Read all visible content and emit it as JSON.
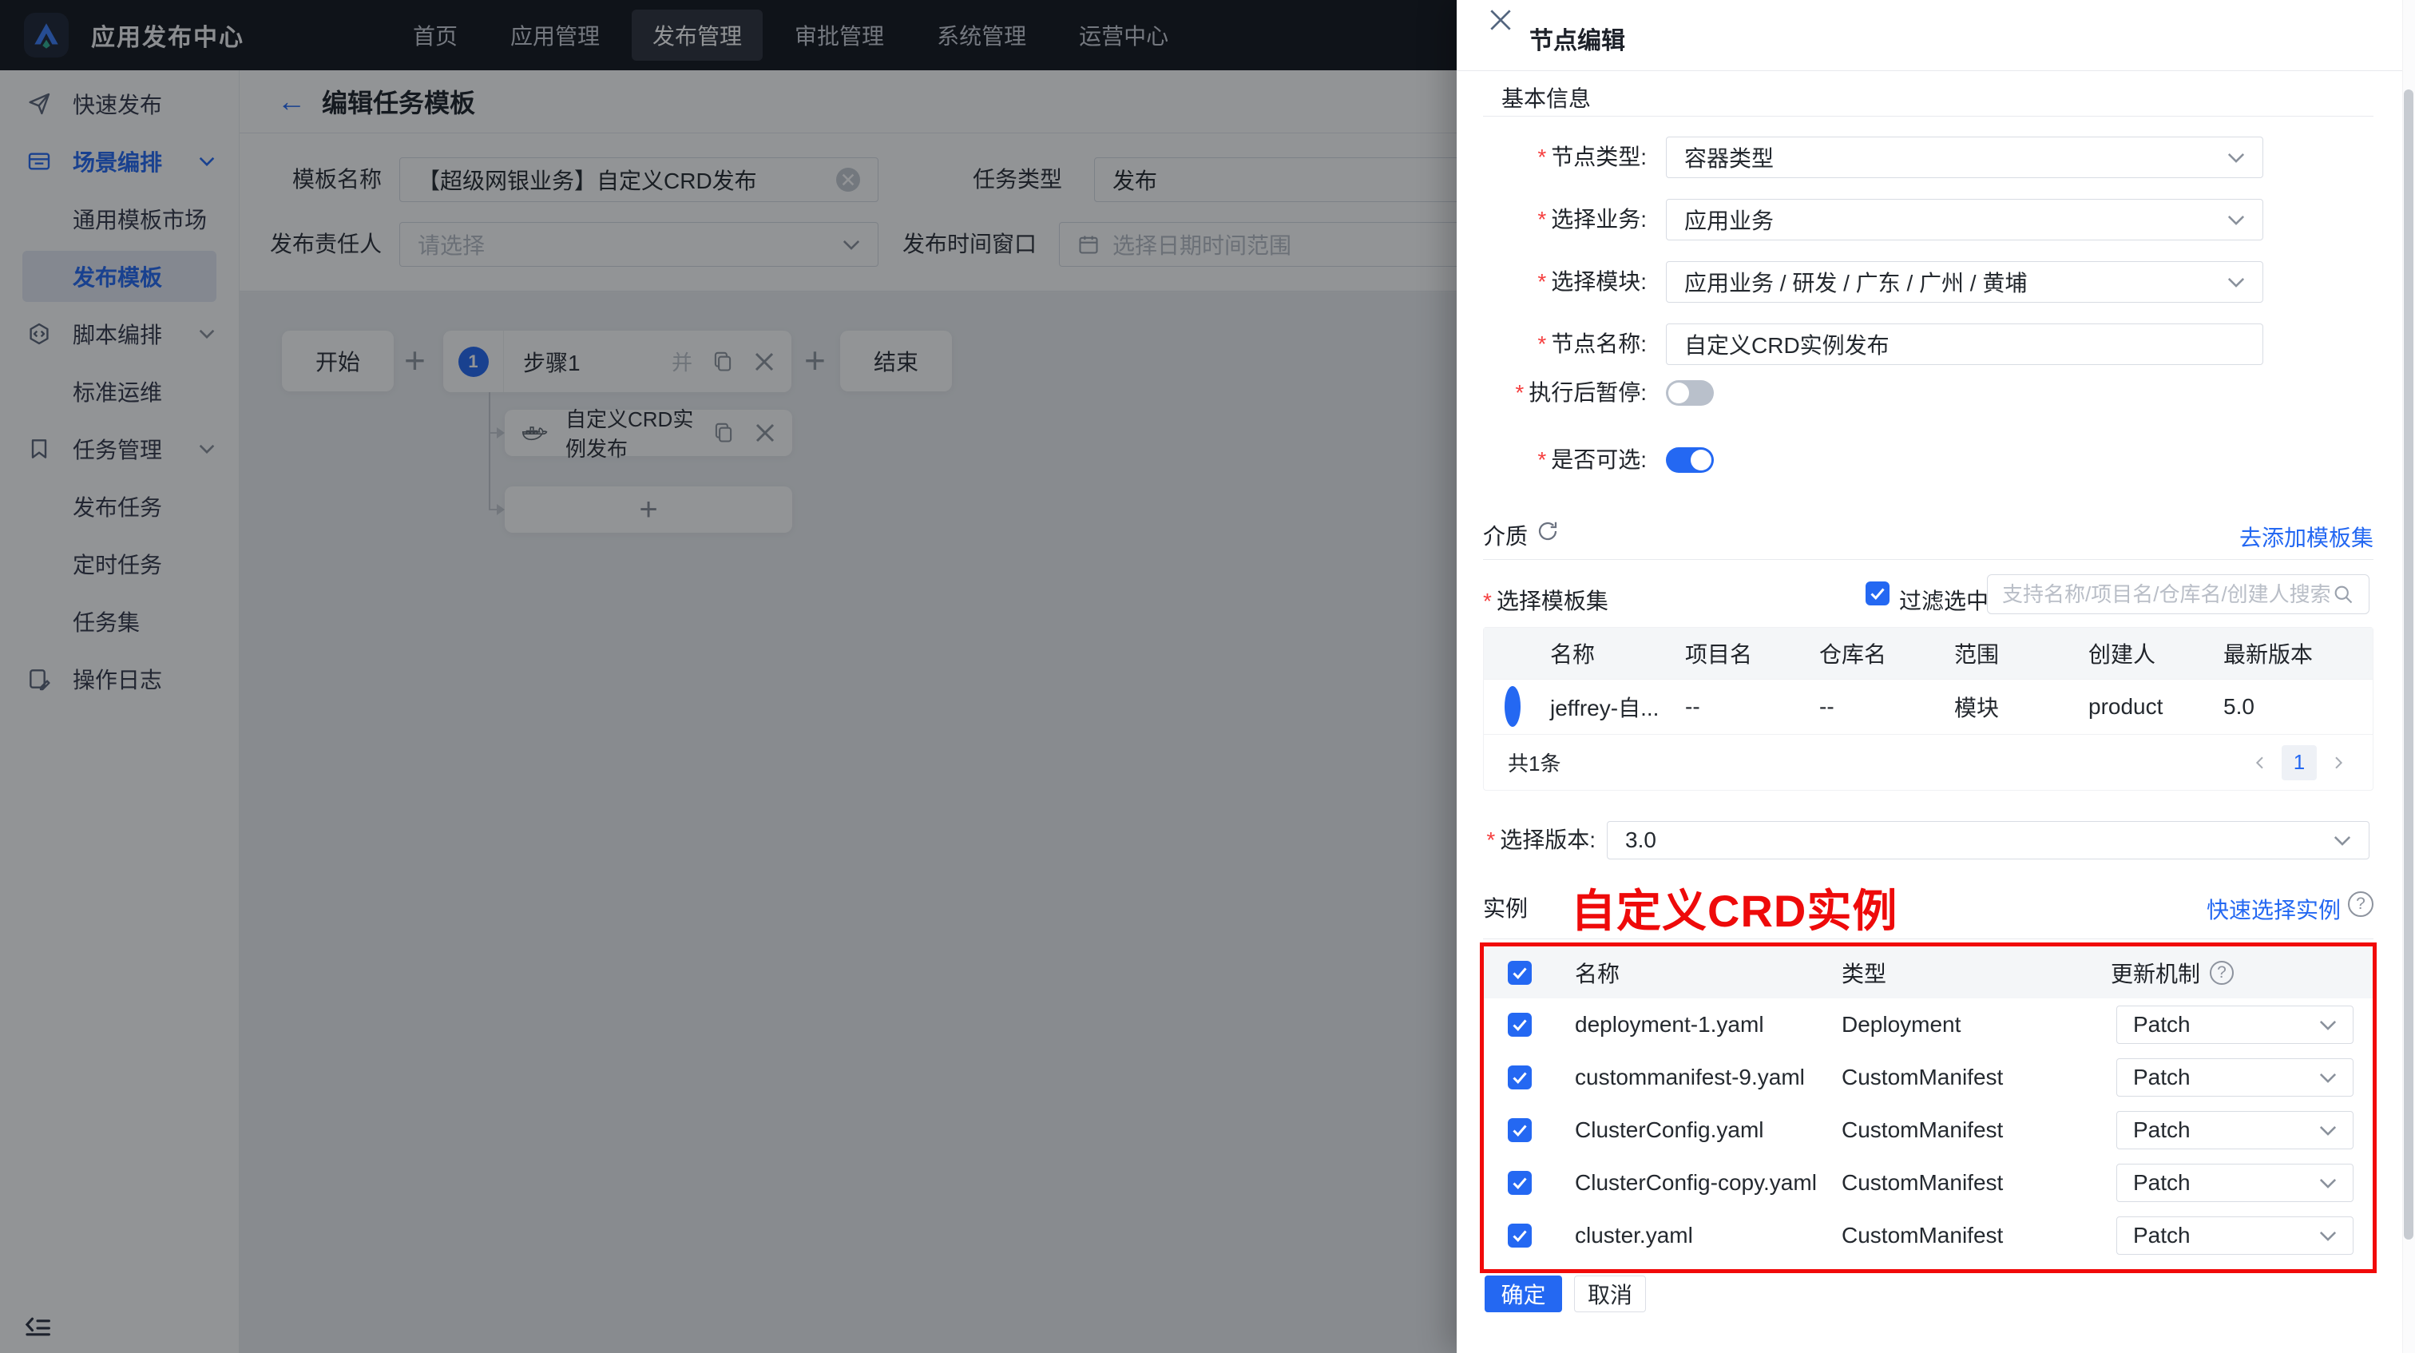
{
  "colors": {
    "accent": "#2468f2",
    "annotation_red": "#ee0a0a",
    "navbar_bg": "#12141d",
    "overlay": "rgba(13,17,23,0.45)"
  },
  "required_mark": "*",
  "navbar": {
    "title": "应用发布中心",
    "menu": [
      {
        "label": "首页"
      },
      {
        "label": "应用管理"
      },
      {
        "label": "发布管理"
      },
      {
        "label": "审批管理"
      },
      {
        "label": "系统管理"
      },
      {
        "label": "运营中心"
      }
    ],
    "active": "发布管理"
  },
  "sidebar": {
    "items": [
      {
        "label": "快速发布"
      },
      {
        "label": "场景编排"
      },
      {
        "label": "通用模板市场"
      },
      {
        "label": "发布模板"
      },
      {
        "label": "脚本编排"
      },
      {
        "label": "标准运维"
      },
      {
        "label": "任务管理"
      },
      {
        "label": "发布任务"
      },
      {
        "label": "定时任务"
      },
      {
        "label": "任务集"
      },
      {
        "label": "操作日志"
      }
    ],
    "active": "发布模板"
  },
  "main": {
    "page_title": "编辑任务模板",
    "form": {
      "template_name_label": "模板名称",
      "template_name_value": "【超级网银业务】自定义CRD发布",
      "task_type_label": "任务类型",
      "task_type_value": "发布",
      "owner_label": "发布责任人",
      "owner_placeholder": "请选择",
      "window_label": "发布时间窗口",
      "window_placeholder": "选择日期时间范围"
    },
    "flow": {
      "start": "开始",
      "step_index": "1",
      "step_label": "步骤1",
      "parallel_glyph": "并",
      "node_label": "自定义CRD实例发布",
      "end": "结束"
    }
  },
  "drawer": {
    "title": "节点编辑",
    "basic_section": "基本信息",
    "fields": {
      "node_type_label": "节点类型:",
      "node_type_value": "容器类型",
      "business_label": "选择业务:",
      "business_value": "应用业务",
      "module_label": "选择模块:",
      "module_value": "应用业务 / 研发 / 广东 / 广州 / 黄埔",
      "node_name_label": "节点名称:",
      "node_name_value": "自定义CRD实例发布",
      "pause_label": "执行后暂停:",
      "optional_label": "是否可选:"
    },
    "media_section": "介质",
    "add_template_link": "去添加模板集",
    "template_set": {
      "label": "选择模板集",
      "filter_label": "过滤选中",
      "search_placeholder": "支持名称/项目名/仓库名/创建人搜索",
      "headers": [
        "名称",
        "项目名",
        "仓库名",
        "范围",
        "创建人",
        "最新版本"
      ],
      "row": {
        "name": "jeffrey-自...",
        "project": "--",
        "repo": "--",
        "scope": "模块",
        "creator": "product",
        "latest": "5.0"
      },
      "total": "共1条",
      "page": "1"
    },
    "version": {
      "label": "选择版本:",
      "value": "3.0"
    },
    "instance_section": "实例",
    "annotation": "自定义CRD实例",
    "quick_select_link": "快速选择实例",
    "instances": {
      "headers": [
        "名称",
        "类型",
        "更新机制"
      ],
      "rows": [
        {
          "name": "deployment-1.yaml",
          "type": "Deployment",
          "mechanism": "Patch"
        },
        {
          "name": "custommanifest-9.yaml",
          "type": "CustomManifest",
          "mechanism": "Patch"
        },
        {
          "name": "ClusterConfig.yaml",
          "type": "CustomManifest",
          "mechanism": "Patch"
        },
        {
          "name": "ClusterConfig-copy.yaml",
          "type": "CustomManifest",
          "mechanism": "Patch"
        },
        {
          "name": "cluster.yaml",
          "type": "CustomManifest",
          "mechanism": "Patch"
        }
      ]
    },
    "ok_button": "确定",
    "cancel_button": "取消"
  }
}
